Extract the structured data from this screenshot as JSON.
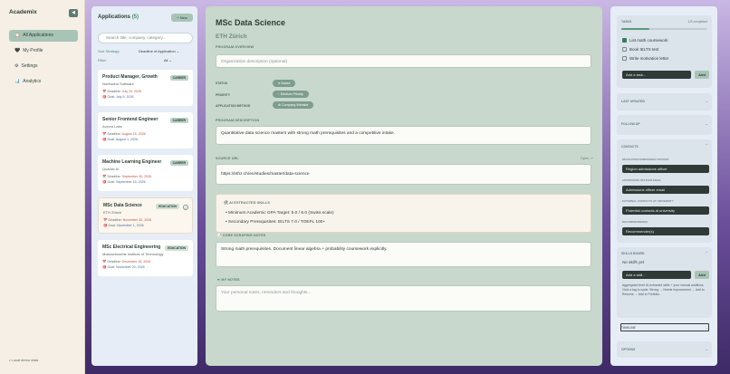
{
  "app": {
    "name": "Academix",
    "collapse_icon": "◀"
  },
  "nav": [
    {
      "icon": "📋",
      "label": "All Applications",
      "active": true
    },
    {
      "icon": "🖤",
      "label": "My Profile"
    },
    {
      "icon": "⚙",
      "label": "Settings"
    },
    {
      "icon": "📊",
      "label": "Analytics"
    }
  ],
  "demo": "• Local demo data",
  "list": {
    "title": "Applications",
    "count": "(5)",
    "new_label": "+ New",
    "search_placeholder": "Search title, company, category...",
    "sort_label": "Sort Strategy:",
    "sort_value": "Deadline of Application ⌄",
    "filter_label": "Filter:",
    "filter_value": "All ⌄",
    "deadline_word": "Deadline:",
    "goal_word": "Goal:",
    "cards": [
      {
        "title": "Product Manager, Growth",
        "company": "Northwind Software",
        "badge": "CAREER",
        "deadline": "July 20, 2026",
        "goal": "July 5, 2026"
      },
      {
        "title": "Senior Frontend Engineer",
        "company": "Aurora Labs",
        "badge": "CAREER",
        "deadline": "August 15, 2026",
        "goal": "August 1, 2026"
      },
      {
        "title": "Machine Learning Engineer",
        "company": "Quantic AI",
        "badge": "CAREER",
        "deadline": "September 30, 2026",
        "goal": "September 15, 2026"
      },
      {
        "title": "MSc Data Science",
        "company": "ETH Zürich",
        "badge": "EDUCATION",
        "deadline": "November 30, 2026",
        "goal": "November 1, 2026",
        "selected": true
      },
      {
        "title": "MSc Electrical Engineering",
        "company": "Massachusetts Institute of Technology",
        "badge": "EDUCATION",
        "deadline": "December 15, 2026",
        "goal": "November 20, 2026"
      }
    ]
  },
  "detail": {
    "title": "MSc Data Science",
    "org": "ETH Zürich",
    "overview_label": "PROGRAM OVERVIEW",
    "overview_placeholder": "Organization description (optional)",
    "status_label": "STATUS",
    "status_value": "Saved",
    "priority_label": "PRIORITY",
    "priority_value": "Medium Priority",
    "method_label": "APPLICATION METHOD",
    "method_value": "Company Website",
    "desc_label": "PROGRAM DESCRIPTION",
    "desc_value": "Quantitative data science masters with strong math prerequisites and a competitive intake.",
    "source_label": "SOURCE URL",
    "open_label": "Open ↗",
    "source_value": "https://ethz.ch/en/studies/master/data-science",
    "ai_title": "🛠 AI EXTRACTED SKILLS",
    "ai_items": [
      "•  Minimum Academic GPA Target: 5.0 / 6.0 (Swiss scale)",
      "•  Secondary Prerequisites: IELTS 7.0 / TOEFL 100+"
    ],
    "notes_label": "📝 CORE SCRAPING NOTES",
    "notes_value": "Strong math prerequisites. Document linear algebra + probability coursework explicitly.",
    "my_label": "✏ MY NOTES",
    "my_placeholder": "Your personal notes, reminders and thoughts..."
  },
  "right": {
    "tasks_label": "TASKS",
    "tasks_count": "1/3 completed",
    "tasks": [
      {
        "label": "List math coursework",
        "done": true
      },
      {
        "label": "Book IELTS test",
        "done": false
      },
      {
        "label": "Write motivation letter",
        "done": false
      }
    ],
    "add_task_placeholder": "Add a task...",
    "add_label": "Add",
    "last_updated": "LAST UPDATED",
    "follow_up": "FOLLOW-UP",
    "contacts_label": "CONTACTS",
    "contacts": [
      {
        "label": "RECRUITER/ADMISSIONS OFFICER",
        "value": "Region admissions officer"
      },
      {
        "label": "ADMISSIONS OFFICER EMAIL",
        "value": "Admissions officer email"
      },
      {
        "label": "EXTERNAL CONTACTS AT UNIVERSITY",
        "value": "Potential contacts at university"
      },
      {
        "label": "RECOMMENDER(S)",
        "value": "Recommender(s)"
      }
    ],
    "skills_label": "SKILLS BOARD",
    "no_skills": "No skills yet",
    "add_skill_placeholder": "Add a skill...",
    "skills_help": "Aggregated from AI-extracted skills + your manual additions. Click a tag to cycle: Strong → Needs improvement → Add to Resume → Add to Portfolio.",
    "timeline_label": "TIMELINE",
    "options_label": "OPTIONS",
    "caret": "⌄"
  },
  "colors": {
    "accent": "#7d9d8e",
    "deadline": "#b5563a",
    "goal": "#4a6a9a"
  }
}
